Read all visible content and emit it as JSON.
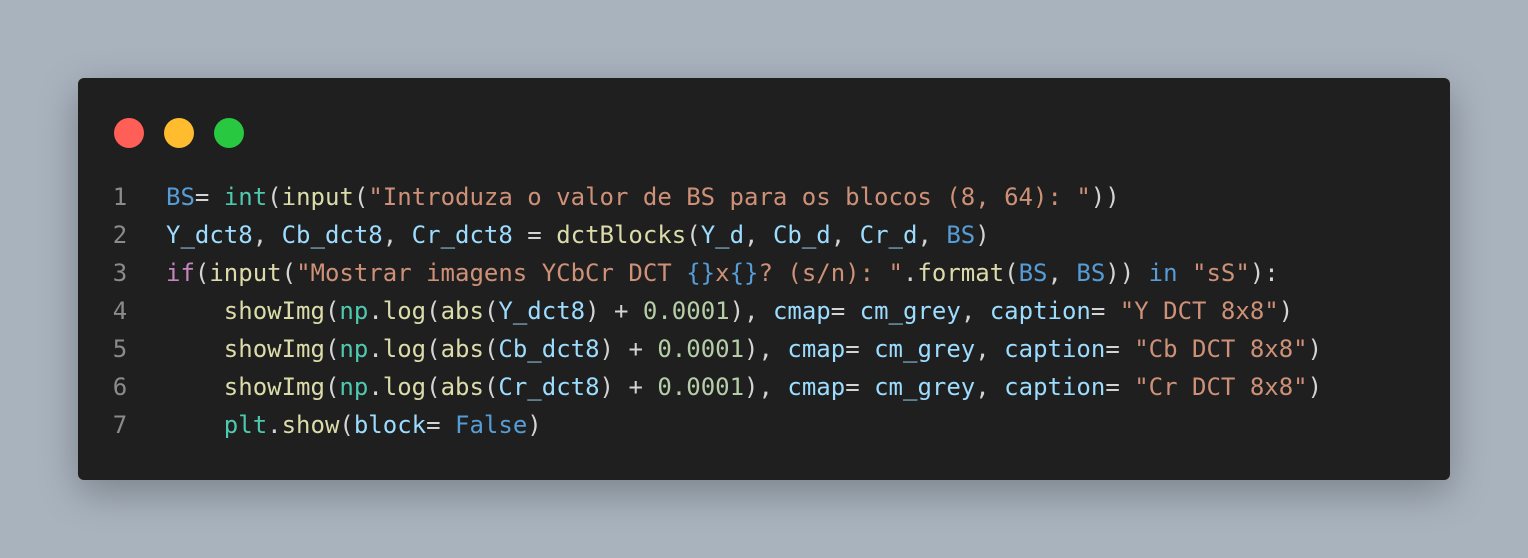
{
  "window": {
    "dots": [
      {
        "name": "close-dot",
        "color": "#ff5f57"
      },
      {
        "name": "minimize-dot",
        "color": "#febc2e"
      },
      {
        "name": "maximize-dot",
        "color": "#28c840"
      }
    ]
  },
  "code": {
    "lines": [
      {
        "number": "1",
        "tokens": [
          {
            "t": "BS",
            "c": "const"
          },
          {
            "t": "= ",
            "c": "plain"
          },
          {
            "t": "int",
            "c": "type"
          },
          {
            "t": "(",
            "c": "plain"
          },
          {
            "t": "input",
            "c": "fn"
          },
          {
            "t": "(",
            "c": "plain"
          },
          {
            "t": "\"Introduza o valor de BS para os blocos (8, 64): \"",
            "c": "str"
          },
          {
            "t": "))",
            "c": "plain"
          }
        ]
      },
      {
        "number": "2",
        "tokens": [
          {
            "t": "Y_dct8",
            "c": "var"
          },
          {
            "t": ", ",
            "c": "plain"
          },
          {
            "t": "Cb_dct8",
            "c": "var"
          },
          {
            "t": ", ",
            "c": "plain"
          },
          {
            "t": "Cr_dct8",
            "c": "var"
          },
          {
            "t": " = ",
            "c": "plain"
          },
          {
            "t": "dctBlocks",
            "c": "fn"
          },
          {
            "t": "(",
            "c": "plain"
          },
          {
            "t": "Y_d",
            "c": "var"
          },
          {
            "t": ", ",
            "c": "plain"
          },
          {
            "t": "Cb_d",
            "c": "var"
          },
          {
            "t": ", ",
            "c": "plain"
          },
          {
            "t": "Cr_d",
            "c": "var"
          },
          {
            "t": ", ",
            "c": "plain"
          },
          {
            "t": "BS",
            "c": "const"
          },
          {
            "t": ")",
            "c": "plain"
          }
        ]
      },
      {
        "number": "3",
        "tokens": [
          {
            "t": "if",
            "c": "kw"
          },
          {
            "t": "(",
            "c": "plain"
          },
          {
            "t": "input",
            "c": "fn"
          },
          {
            "t": "(",
            "c": "plain"
          },
          {
            "t": "\"Mostrar imagens YCbCr DCT ",
            "c": "str"
          },
          {
            "t": "{}",
            "c": "brace"
          },
          {
            "t": "x",
            "c": "str"
          },
          {
            "t": "{}",
            "c": "brace"
          },
          {
            "t": "? (s/n): \"",
            "c": "str"
          },
          {
            "t": ".",
            "c": "plain"
          },
          {
            "t": "format",
            "c": "fn"
          },
          {
            "t": "(",
            "c": "plain"
          },
          {
            "t": "BS",
            "c": "const"
          },
          {
            "t": ", ",
            "c": "plain"
          },
          {
            "t": "BS",
            "c": "const"
          },
          {
            "t": ")) ",
            "c": "plain"
          },
          {
            "t": "in",
            "c": "const"
          },
          {
            "t": " ",
            "c": "plain"
          },
          {
            "t": "\"sS\"",
            "c": "str"
          },
          {
            "t": "):",
            "c": "plain"
          }
        ]
      },
      {
        "number": "4",
        "tokens": [
          {
            "t": "    ",
            "c": "plain"
          },
          {
            "t": "showImg",
            "c": "fn"
          },
          {
            "t": "(",
            "c": "plain"
          },
          {
            "t": "np",
            "c": "type"
          },
          {
            "t": ".",
            "c": "plain"
          },
          {
            "t": "log",
            "c": "fn"
          },
          {
            "t": "(",
            "c": "plain"
          },
          {
            "t": "abs",
            "c": "fn"
          },
          {
            "t": "(",
            "c": "plain"
          },
          {
            "t": "Y_dct8",
            "c": "var"
          },
          {
            "t": ") + ",
            "c": "plain"
          },
          {
            "t": "0.0001",
            "c": "num"
          },
          {
            "t": "), ",
            "c": "plain"
          },
          {
            "t": "cmap",
            "c": "var"
          },
          {
            "t": "= ",
            "c": "plain"
          },
          {
            "t": "cm_grey",
            "c": "var"
          },
          {
            "t": ", ",
            "c": "plain"
          },
          {
            "t": "caption",
            "c": "var"
          },
          {
            "t": "= ",
            "c": "plain"
          },
          {
            "t": "\"Y DCT 8x8\"",
            "c": "str"
          },
          {
            "t": ")",
            "c": "plain"
          }
        ]
      },
      {
        "number": "5",
        "tokens": [
          {
            "t": "    ",
            "c": "plain"
          },
          {
            "t": "showImg",
            "c": "fn"
          },
          {
            "t": "(",
            "c": "plain"
          },
          {
            "t": "np",
            "c": "type"
          },
          {
            "t": ".",
            "c": "plain"
          },
          {
            "t": "log",
            "c": "fn"
          },
          {
            "t": "(",
            "c": "plain"
          },
          {
            "t": "abs",
            "c": "fn"
          },
          {
            "t": "(",
            "c": "plain"
          },
          {
            "t": "Cb_dct8",
            "c": "var"
          },
          {
            "t": ") + ",
            "c": "plain"
          },
          {
            "t": "0.0001",
            "c": "num"
          },
          {
            "t": "), ",
            "c": "plain"
          },
          {
            "t": "cmap",
            "c": "var"
          },
          {
            "t": "= ",
            "c": "plain"
          },
          {
            "t": "cm_grey",
            "c": "var"
          },
          {
            "t": ", ",
            "c": "plain"
          },
          {
            "t": "caption",
            "c": "var"
          },
          {
            "t": "= ",
            "c": "plain"
          },
          {
            "t": "\"Cb DCT 8x8\"",
            "c": "str"
          },
          {
            "t": ")",
            "c": "plain"
          }
        ]
      },
      {
        "number": "6",
        "tokens": [
          {
            "t": "    ",
            "c": "plain"
          },
          {
            "t": "showImg",
            "c": "fn"
          },
          {
            "t": "(",
            "c": "plain"
          },
          {
            "t": "np",
            "c": "type"
          },
          {
            "t": ".",
            "c": "plain"
          },
          {
            "t": "log",
            "c": "fn"
          },
          {
            "t": "(",
            "c": "plain"
          },
          {
            "t": "abs",
            "c": "fn"
          },
          {
            "t": "(",
            "c": "plain"
          },
          {
            "t": "Cr_dct8",
            "c": "var"
          },
          {
            "t": ") + ",
            "c": "plain"
          },
          {
            "t": "0.0001",
            "c": "num"
          },
          {
            "t": "), ",
            "c": "plain"
          },
          {
            "t": "cmap",
            "c": "var"
          },
          {
            "t": "= ",
            "c": "plain"
          },
          {
            "t": "cm_grey",
            "c": "var"
          },
          {
            "t": ", ",
            "c": "plain"
          },
          {
            "t": "caption",
            "c": "var"
          },
          {
            "t": "= ",
            "c": "plain"
          },
          {
            "t": "\"Cr DCT 8x8\"",
            "c": "str"
          },
          {
            "t": ")",
            "c": "plain"
          }
        ]
      },
      {
        "number": "7",
        "tokens": [
          {
            "t": "    ",
            "c": "plain"
          },
          {
            "t": "plt",
            "c": "type"
          },
          {
            "t": ".",
            "c": "plain"
          },
          {
            "t": "show",
            "c": "fn"
          },
          {
            "t": "(",
            "c": "plain"
          },
          {
            "t": "block",
            "c": "var"
          },
          {
            "t": "= ",
            "c": "plain"
          },
          {
            "t": "False",
            "c": "const"
          },
          {
            "t": ")",
            "c": "plain"
          }
        ]
      }
    ]
  }
}
